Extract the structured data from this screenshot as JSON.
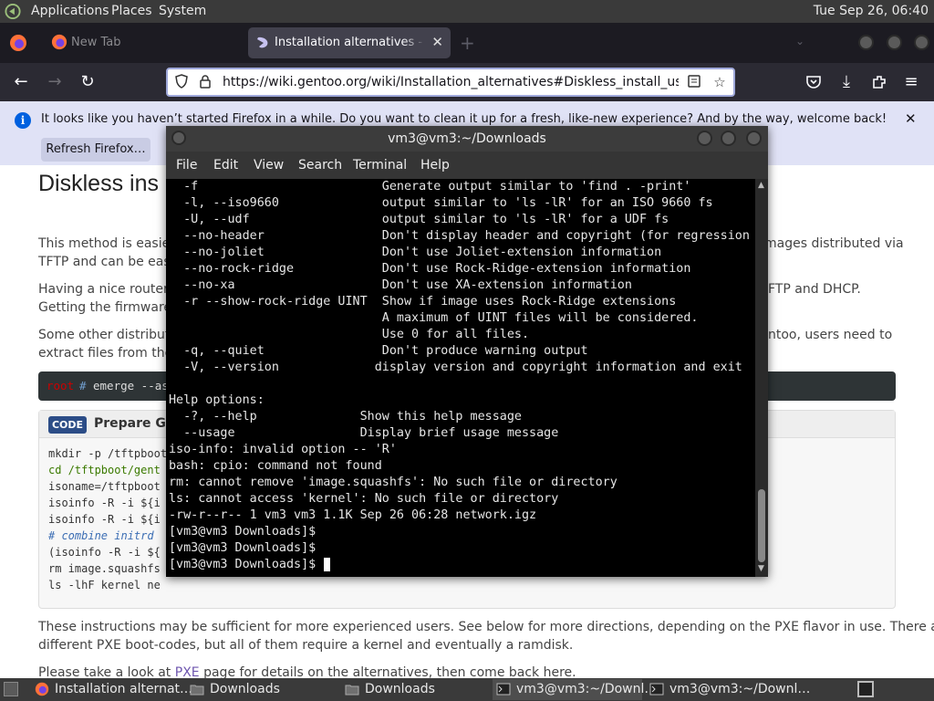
{
  "top_panel": {
    "menus": [
      "Applications",
      "Places",
      "System"
    ],
    "clock": "Tue Sep 26, 06:40"
  },
  "firefox": {
    "tabs": [
      {
        "label": "New Tab",
        "active": false
      },
      {
        "label": "Installation alternatives - Gentoo wiki",
        "active": true
      }
    ],
    "tab_close": "✕",
    "new_tab": "+",
    "url": "https://wiki.gentoo.org/wiki/Installation_alternatives#Diskless_install_using_PXE",
    "notification": {
      "message": "It looks like you haven’t started Firefox in a while. Do you want to clean it up for a fresh, like-new experience? And by the way, welcome back!",
      "button": "Refresh Firefox…"
    }
  },
  "page": {
    "heading": "Diskless ins",
    "p1_left_a": "This method is easier",
    "p1_right_a": "mages distributed via",
    "p1_left_b": "TFTP and can be easil",
    "p2_left_a": "Having a nice router,",
    "p2_right_a": "FTP and DHCP.",
    "p2_left_b": "Getting the firmware",
    "p3_left_a": "Some other distributi",
    "p3_right_a": "ntoo, users need to",
    "p3_left_b": "extract files from the",
    "shell": {
      "prompt_user": "root",
      "prompt_hash": "#",
      "command": "emerge --as"
    },
    "codebox": {
      "badge": "CODE",
      "title": "Prepare Ge",
      "lines": [
        "mkdir -p /tftpboot",
        "cd /tftpboot/gent",
        "isoname=/tftpboot",
        "isoinfo -R -i ${i",
        "isoinfo -R -i ${i",
        "# combine initrd",
        "(isoinfo -R -i ${",
        "rm image.squashfs",
        "ls -lhF kernel ne"
      ]
    },
    "p4a": "These instructions may be sufficient for more experienced users. See below for more directions, depending on the PXE flavor in use. There are",
    "p4b": "different PXE boot-codes, but all of them require a kernel and eventually a ramdisk.",
    "p5_before": "Please take a look at ",
    "p5_link": "PXE",
    "p5_after": " page for details on the alternatives, then come back here."
  },
  "terminal": {
    "title": "vm3@vm3:~/Downloads",
    "menu": [
      "File",
      "Edit",
      "View",
      "Search",
      "Terminal",
      "Help"
    ],
    "lines": [
      "  -f                         Generate output similar to 'find . -print'",
      "  -l, --iso9660              output similar to 'ls -lR' for an ISO 9660 fs",
      "  -U, --udf                  output similar to 'ls -lR' for a UDF fs",
      "  --no-header                Don't display header and copyright (for regression",
      "  --no-joliet                Don't use Joliet-extension information",
      "  --no-rock-ridge            Don't use Rock-Ridge-extension information",
      "  --no-xa                    Don't use XA-extension information",
      "  -r --show-rock-ridge UINT  Show if image uses Rock-Ridge extensions",
      "                             A maximum of UINT files will be considered.",
      "                             Use 0 for all files.",
      "  -q, --quiet                Don't produce warning output",
      "  -V, --version             display version and copyright information and exit",
      "",
      "Help options:",
      "  -?, --help              Show this help message",
      "  --usage                 Display brief usage message",
      "iso-info: invalid option -- 'R'",
      "bash: cpio: command not found",
      "rm: cannot remove 'image.squashfs': No such file or directory",
      "ls: cannot access 'kernel': No such file or directory",
      "-rw-r--r-- 1 vm3 vm3 1.1K Sep 26 06:28 network.igz",
      "[vm3@vm3 Downloads]$",
      "[vm3@vm3 Downloads]$",
      "[vm3@vm3 Downloads]$ "
    ]
  },
  "taskbar": {
    "items": [
      {
        "label": "Installation alternat…",
        "icon": "firefox-icon"
      },
      {
        "label": "Downloads",
        "icon": "folder-icon"
      },
      {
        "label": "Downloads",
        "icon": "folder-icon"
      },
      {
        "label": "vm3@vm3:~/Downl…",
        "icon": "terminal-icon"
      },
      {
        "label": "vm3@vm3:~/Downl…",
        "icon": "terminal-icon"
      }
    ]
  }
}
